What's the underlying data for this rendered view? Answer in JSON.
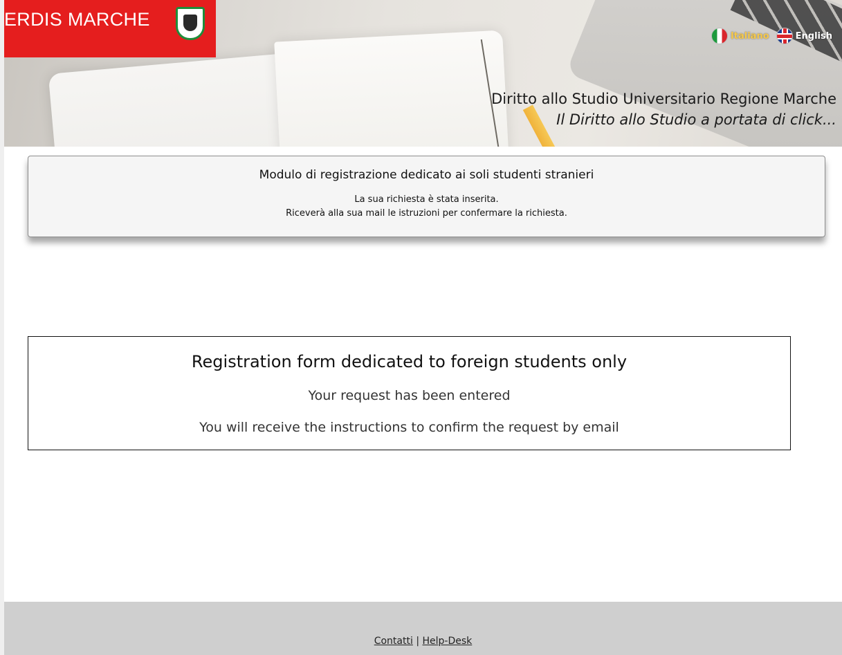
{
  "header": {
    "logo_text": "ERDIS MARCHE",
    "tagline_line1": "Diritto allo Studio Universitario Regione Marche",
    "tagline_line2": "Il Diritto allo Studio a portata di click...",
    "languages": [
      {
        "label": "Italiano",
        "icon": "italy-flag-icon"
      },
      {
        "label": "English",
        "icon": "uk-flag-icon"
      }
    ]
  },
  "notice": {
    "title": "Modulo di registrazione dedicato ai soli studenti stranieri",
    "line1": "La sua richiesta è stata inserita.",
    "line2": "Riceverà alla sua mail le istruzioni per confermare la richiesta."
  },
  "english_box": {
    "title": "Registration form dedicated to foreign students only",
    "line1": "Your request has been entered",
    "line2": "You will receive the instructions to confirm the request by email"
  },
  "footer": {
    "contacts_label": "Contatti",
    "separator": "|",
    "helpdesk_label": "Help-Desk"
  },
  "colors": {
    "brand_red": "#e51e1e",
    "footer_gray": "#cfcfcf",
    "active_language": "#f6c94a"
  }
}
